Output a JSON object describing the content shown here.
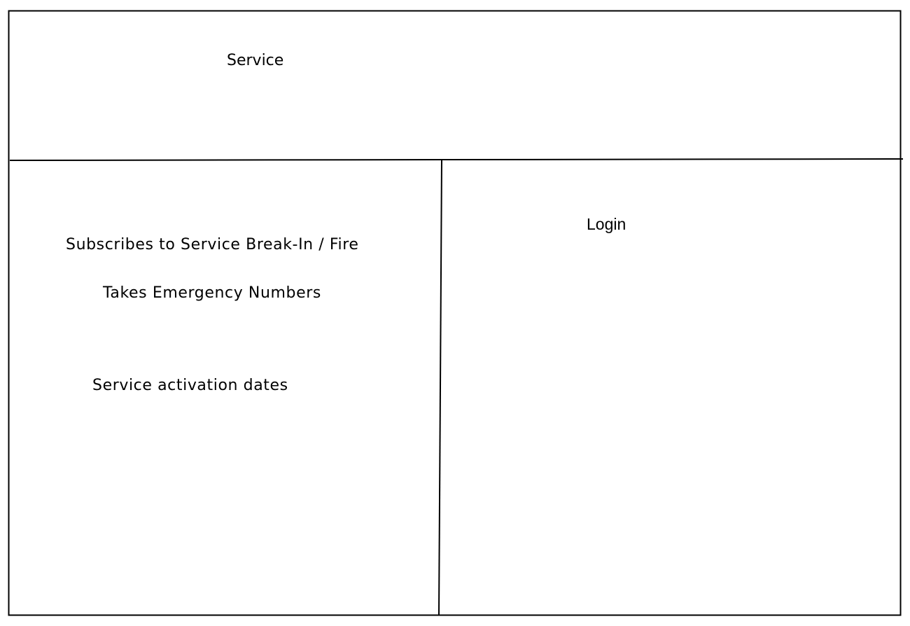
{
  "header": {
    "title": "Service"
  },
  "left_panel": {
    "items": [
      "Subscribes to Service Break-In / Fire",
      "Takes Emergency Numbers",
      "Service activation dates"
    ]
  },
  "right_panel": {
    "title": "Login"
  },
  "colors": {
    "stroke": "#000000",
    "background": "#ffffff"
  }
}
